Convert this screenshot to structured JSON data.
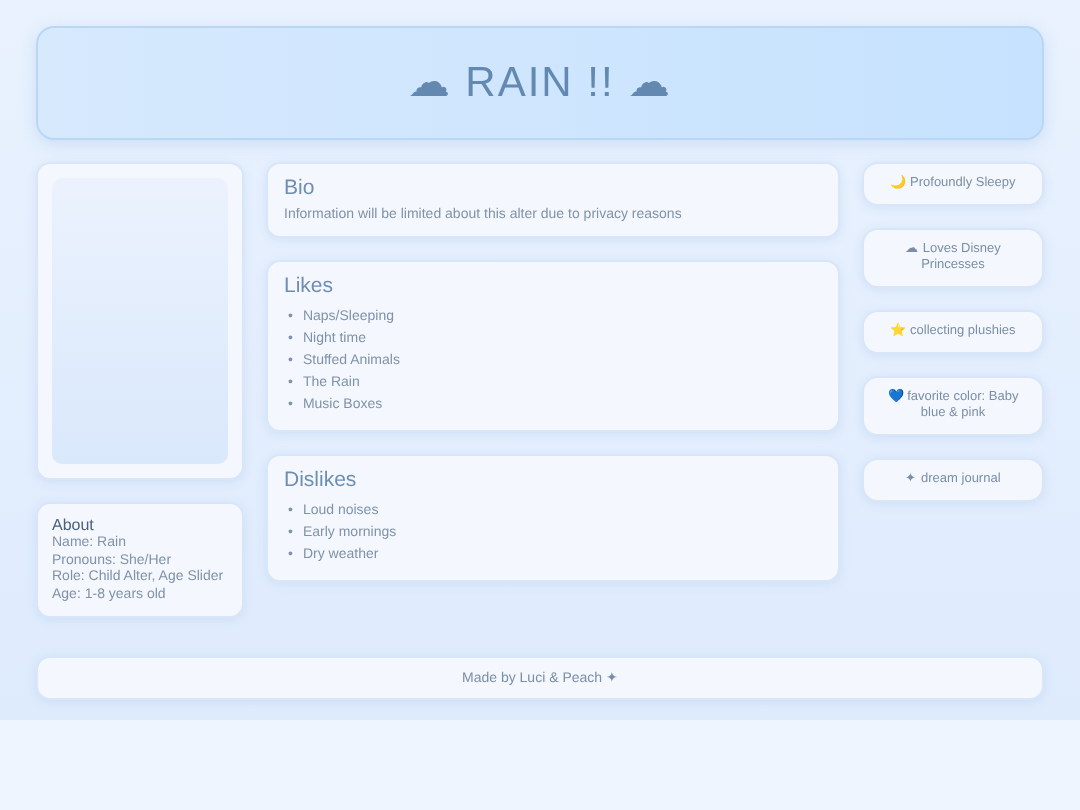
{
  "header": {
    "title": "☁ RAIN !! ☁"
  },
  "about": {
    "heading": "About",
    "lines": [
      "Name: Rain",
      "Pronouns: She/Her",
      "Role: Child Alter, Age Slider",
      "Age: 1-8 years old"
    ]
  },
  "sections": [
    {
      "heading": "Bio",
      "text": "Information will be limited about this alter due to privacy reasons"
    },
    {
      "heading": "Likes",
      "bullet": "•",
      "items": [
        "Naps/Sleeping",
        "Night time",
        "Stuffed Animals",
        "The Rain",
        "Music Boxes"
      ]
    },
    {
      "heading": "Dislikes",
      "bullet": "•",
      "items": [
        "Loud noises",
        "Early mornings",
        "Dry weather"
      ]
    }
  ],
  "tags": [
    "🌙 Profoundly Sleepy",
    "☁ Loves Disney Princesses",
    "⭐ collecting plushies",
    "💙 favorite color: Baby blue & pink",
    "✦ dream journal"
  ],
  "footer": "Made by Luci & Peach ✦"
}
